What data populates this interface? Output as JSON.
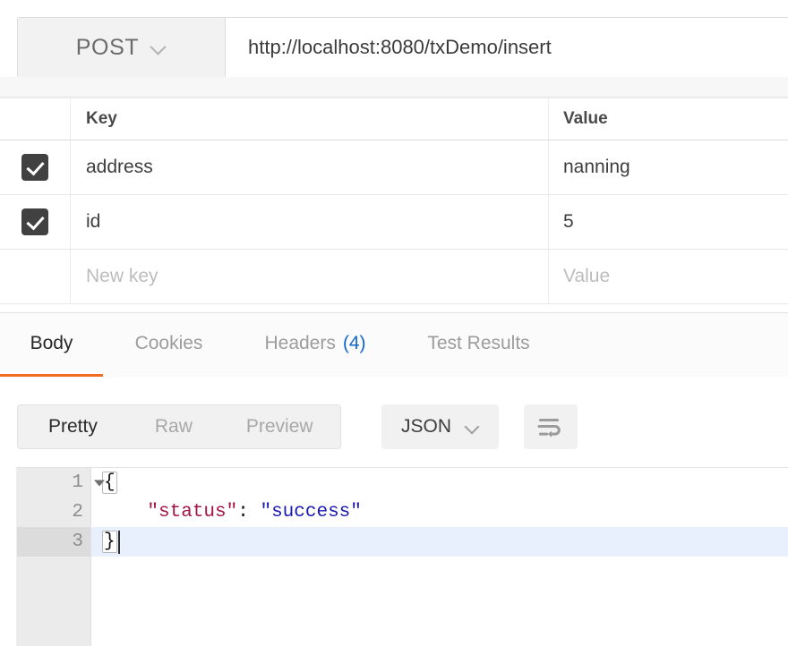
{
  "request": {
    "method": "POST",
    "method_dropdown_icon": "chevron-down-icon",
    "url": "http://localhost:8080/txDemo/insert"
  },
  "params_table": {
    "columns": {
      "check": "",
      "key": "Key",
      "value": "Value"
    },
    "rows": [
      {
        "checked": true,
        "key": "address",
        "value": "nanning"
      },
      {
        "checked": true,
        "key": "id",
        "value": "5"
      }
    ],
    "new_row": {
      "key_placeholder": "New key",
      "value_placeholder": "Value"
    }
  },
  "response": {
    "tabs": [
      {
        "label": "Body",
        "active": true,
        "count": ""
      },
      {
        "label": "Cookies",
        "active": false,
        "count": ""
      },
      {
        "label": "Headers",
        "active": false,
        "count": "(4)"
      },
      {
        "label": "Test Results",
        "active": false,
        "count": ""
      }
    ],
    "format_toolbar": {
      "segments": [
        {
          "label": "Pretty",
          "active": true
        },
        {
          "label": "Raw",
          "active": false
        },
        {
          "label": "Preview",
          "active": false
        }
      ],
      "language": "JSON",
      "language_dropdown_icon": "chevron-down-icon",
      "wrap_button_icon": "word-wrap-icon"
    },
    "body": {
      "lines": [
        {
          "number": "1",
          "foldable": true,
          "active": false,
          "open_brace": "{"
        },
        {
          "number": "2",
          "foldable": false,
          "active": false,
          "indent": "    ",
          "key": "\"status\"",
          "colon": ": ",
          "value": "\"success\""
        },
        {
          "number": "3",
          "foldable": false,
          "active": true,
          "close_brace": "}"
        }
      ]
    }
  },
  "colors": {
    "accent_orange": "#f26b21",
    "badge_blue": "#1267cf",
    "json_key": "#a31545",
    "json_string": "#1a1ab0",
    "checkbox": "#414141",
    "active_line": "#e8f0fe"
  }
}
